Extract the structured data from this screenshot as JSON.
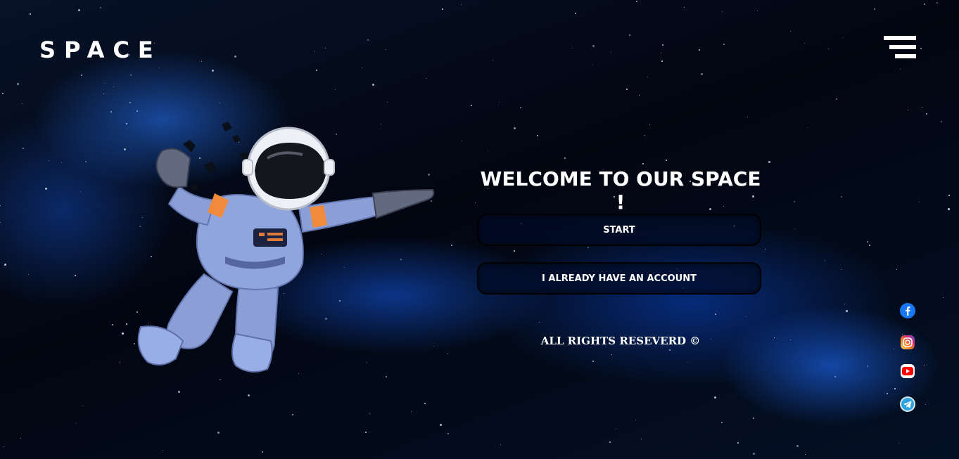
{
  "header": {
    "logo": "SPACE",
    "menu_icon": "hamburger-menu-icon"
  },
  "hero": {
    "title": "WELCOME TO OUR SPACE !",
    "start_label": "START",
    "account_label": "I ALREADY HAVE AN ACCOUNT",
    "rights": "ALL RIGHTS RESEVERD ©"
  },
  "social": [
    {
      "name": "facebook-icon",
      "color": "#1877f2"
    },
    {
      "name": "instagram-icon",
      "color": "#d6249f"
    },
    {
      "name": "youtube-icon",
      "color": "#ff0000"
    },
    {
      "name": "telegram-icon",
      "color": "#2aa3df"
    }
  ],
  "colors": {
    "background": "#020611",
    "nebula": "#1f6bff",
    "button_bg": "#020c28",
    "text": "#ffffff"
  }
}
